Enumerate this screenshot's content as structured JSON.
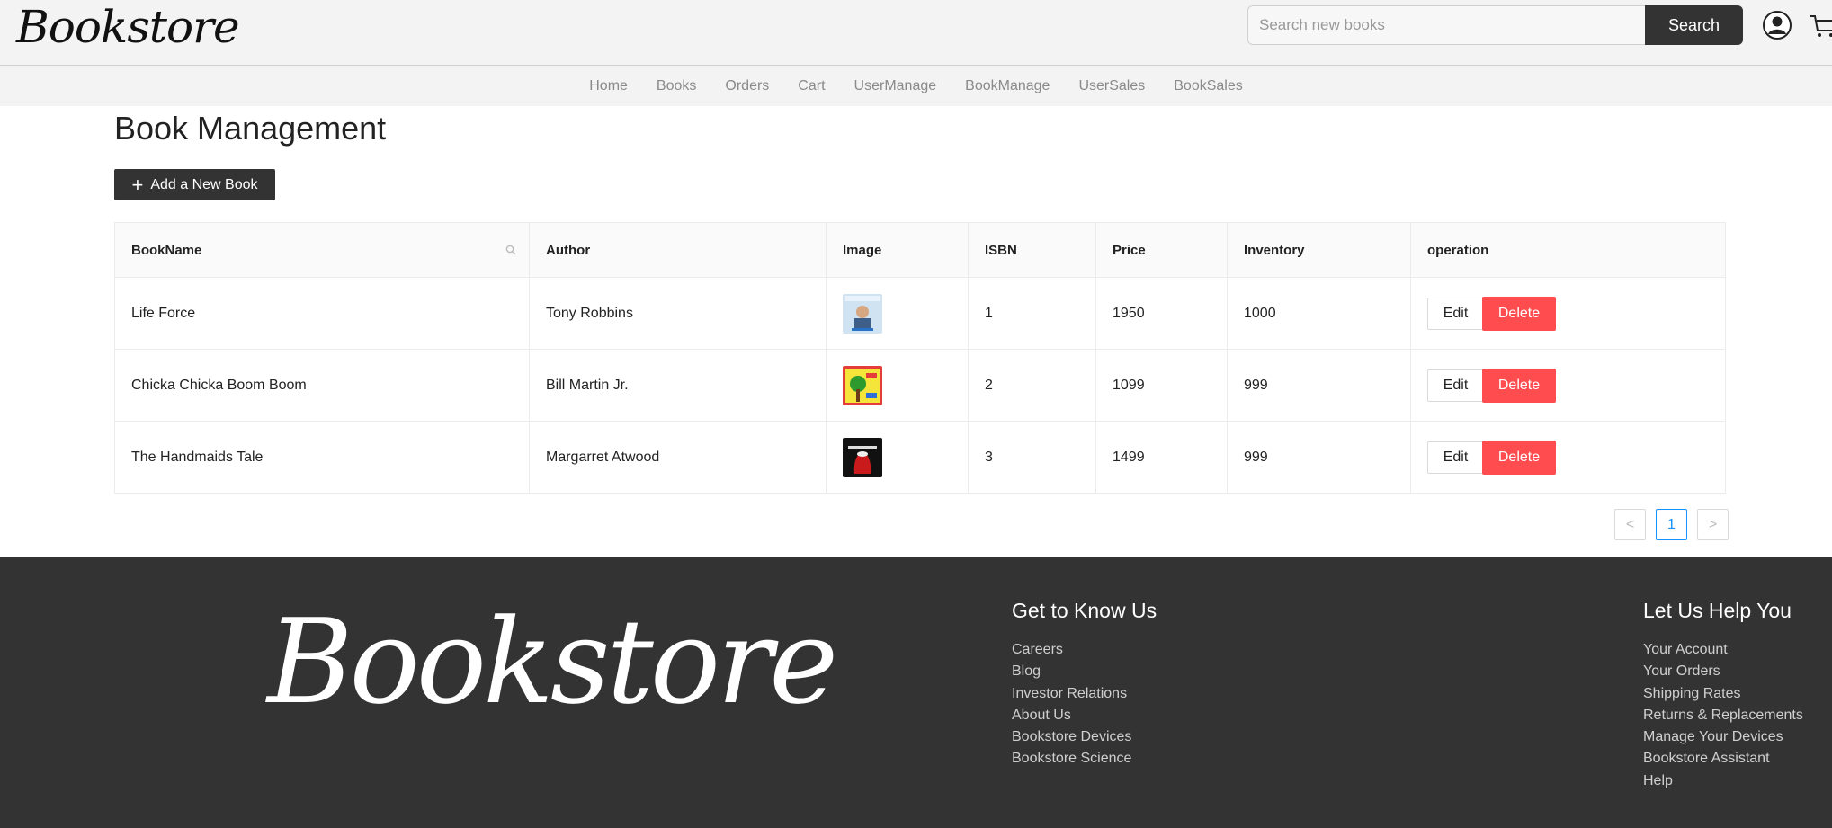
{
  "brand": {
    "logo_text": "Bookstore"
  },
  "search": {
    "placeholder": "Search new books",
    "value": "",
    "button_label": "Search"
  },
  "nav": {
    "items": [
      "Home",
      "Books",
      "Orders",
      "Cart",
      "UserManage",
      "BookManage",
      "UserSales",
      "BookSales"
    ]
  },
  "page": {
    "title": "Book Management",
    "add_button_label": "Add a New Book"
  },
  "table": {
    "columns": [
      "BookName",
      "Author",
      "Image",
      "ISBN",
      "Price",
      "Inventory",
      "operation"
    ],
    "rows": [
      {
        "name": "Life Force",
        "author": "Tony Robbins",
        "isbn": "1",
        "price": "1950",
        "inventory": "1000"
      },
      {
        "name": "Chicka Chicka Boom Boom",
        "author": "Bill Martin Jr.",
        "isbn": "2",
        "price": "1099",
        "inventory": "999"
      },
      {
        "name": "The Handmaids Tale",
        "author": "Margarret Atwood",
        "isbn": "3",
        "price": "1499",
        "inventory": "999"
      }
    ],
    "edit_label": "Edit",
    "delete_label": "Delete"
  },
  "pagination": {
    "current": "1",
    "prev_symbol": "<",
    "next_symbol": ">"
  },
  "footer": {
    "logo_text": "Bookstore",
    "col1": {
      "title": "Get to Know Us",
      "links": [
        "Careers",
        "Blog",
        "Investor Relations",
        "About Us",
        "Bookstore Devices",
        "Bookstore Science"
      ]
    },
    "col2": {
      "title": "Let Us Help You",
      "links": [
        "Your Account",
        "Your Orders",
        "Shipping Rates",
        "Returns & Replacements",
        "Manage Your Devices",
        "Bookstore Assistant",
        "Help"
      ]
    }
  },
  "colors": {
    "header_bg": "#f3f3f3",
    "dark": "#333333",
    "danger": "#ff4d4f",
    "accent": "#1890ff"
  },
  "icons": [
    "user-avatar-icon",
    "cart-icon",
    "column-search-icon",
    "plus-icon",
    "chevron-left-icon",
    "chevron-right-icon"
  ]
}
